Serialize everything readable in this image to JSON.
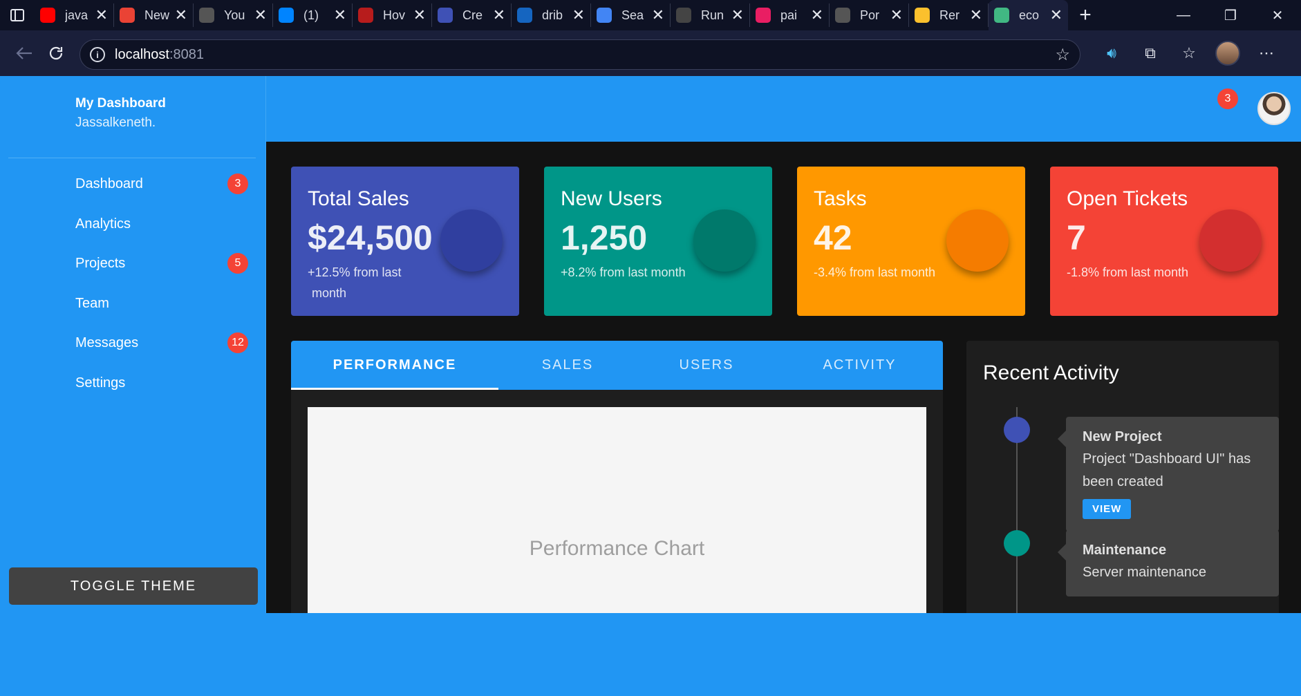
{
  "browser": {
    "tabs": [
      {
        "title": "java",
        "icon": "youtube-icon",
        "color": "#ff0000"
      },
      {
        "title": "New",
        "icon": "gmail-icon",
        "color": "#ea4335"
      },
      {
        "title": "You",
        "icon": "facebook-icon",
        "color": "#555"
      },
      {
        "title": "(1)",
        "icon": "messenger-icon",
        "color": "#0084ff"
      },
      {
        "title": "Hov",
        "icon": "video-icon",
        "color": "#b71c1c"
      },
      {
        "title": "Cre",
        "icon": "cloud-icon",
        "color": "#3f51b5"
      },
      {
        "title": "drib",
        "icon": "search-icon",
        "color": "#1565c0"
      },
      {
        "title": "Sea",
        "icon": "google-icon",
        "color": "#4285f4"
      },
      {
        "title": "Run",
        "icon": "openai-icon",
        "color": "#444"
      },
      {
        "title": "pai",
        "icon": "paint-icon",
        "color": "#e91e63"
      },
      {
        "title": "Por",
        "icon": "globe-icon",
        "color": "#555"
      },
      {
        "title": "Rer",
        "icon": "book-icon",
        "color": "#fbc02d"
      },
      {
        "title": "eco",
        "icon": "vue-icon",
        "color": "#41b883"
      }
    ],
    "url_host": "localhost",
    "url_port": ":8081"
  },
  "sidebar": {
    "brand": "My Dashboard",
    "user": "Jassalkeneth.",
    "items": [
      {
        "label": "Dashboard",
        "badge": "3"
      },
      {
        "label": "Analytics",
        "badge": ""
      },
      {
        "label": "Projects",
        "badge": "5"
      },
      {
        "label": "Team",
        "badge": ""
      },
      {
        "label": "Messages",
        "badge": "12"
      },
      {
        "label": "Settings",
        "badge": ""
      }
    ],
    "toggle_label": "TOGGLE THEME"
  },
  "topbar": {
    "notification_count": "3"
  },
  "stats": [
    {
      "title": "Total Sales",
      "value": "$24,500",
      "change": "+12.5% from last month",
      "color": "#3f51b5",
      "circle": "#303f9f"
    },
    {
      "title": "New Users",
      "value": "1,250",
      "change": "+8.2% from last month",
      "color": "#009688",
      "circle": "#00796b"
    },
    {
      "title": "Tasks",
      "value": "42",
      "change": "-3.4% from last month",
      "color": "#ff9800",
      "circle": "#f57c00"
    },
    {
      "title": "Open Tickets",
      "value": "7",
      "change": "-1.8% from last month",
      "color": "#f44336",
      "circle": "#d32f2f"
    }
  ],
  "tabs": [
    "PERFORMANCE",
    "SALES",
    "USERS",
    "ACTIVITY"
  ],
  "chart_placeholder": "Performance Chart",
  "activity": {
    "title": "Recent Activity",
    "items": [
      {
        "title": "New Project",
        "desc": "Project \"Dashboard UI\" has been created",
        "button": "VIEW",
        "color": "#3f51b5"
      },
      {
        "title": "Maintenance",
        "desc": "Server maintenance",
        "button": "",
        "color": "#009688"
      }
    ]
  }
}
